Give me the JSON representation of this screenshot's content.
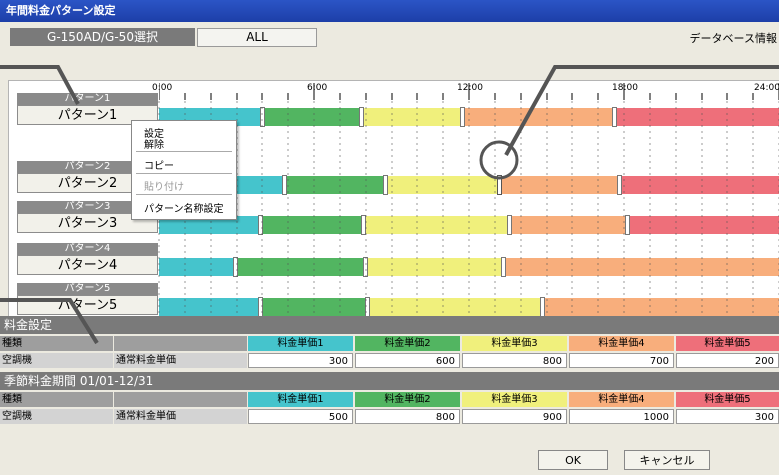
{
  "window": {
    "title": "年間料金パターン設定"
  },
  "top": {
    "selector_label": "G-150AD/G-50選択",
    "scope_value": "ALL",
    "db_info": "データベース情報"
  },
  "ruler": {
    "labels": [
      "0:00",
      "6:00",
      "12:00",
      "18:00",
      "24:00"
    ]
  },
  "patterns": [
    {
      "label": "パターン1",
      "button": "パターン1"
    },
    {
      "label": "パターン2",
      "button": "パターン2"
    },
    {
      "label": "パターン3",
      "button": "パターン3"
    },
    {
      "label": "パターン4",
      "button": "パターン4"
    },
    {
      "label": "パターン5",
      "button": "パターン5"
    }
  ],
  "context_menu": {
    "items": [
      "設定",
      "解除",
      "コピー",
      "貼り付け",
      "パターン名称設定"
    ]
  },
  "colors": {
    "price1": "#45c4cc",
    "price2": "#52b561",
    "price3": "#f0f07c",
    "price4": "#f8ae7c",
    "price5": "#ee6f7a"
  },
  "rate_section": {
    "title": "料金設定",
    "type_header": "種類",
    "price_headers": [
      "料金単価1",
      "料金単価2",
      "料金単価3",
      "料金単価4",
      "料金単価5"
    ],
    "row_type": "空調機",
    "row_kind": "通常料金単価",
    "values": [
      "300",
      "600",
      "800",
      "700",
      "200"
    ]
  },
  "season_section": {
    "title": "季節料金期間 01/01-12/31",
    "type_header": "種類",
    "price_headers": [
      "料金単価1",
      "料金単価2",
      "料金単価3",
      "料金単価4",
      "料金単価5"
    ],
    "row_type": "空調機",
    "row_kind": "通常料金単価",
    "values": [
      "500",
      "800",
      "900",
      "1000",
      "300"
    ]
  },
  "buttons": {
    "ok": "OK",
    "cancel": "キャンセル"
  }
}
